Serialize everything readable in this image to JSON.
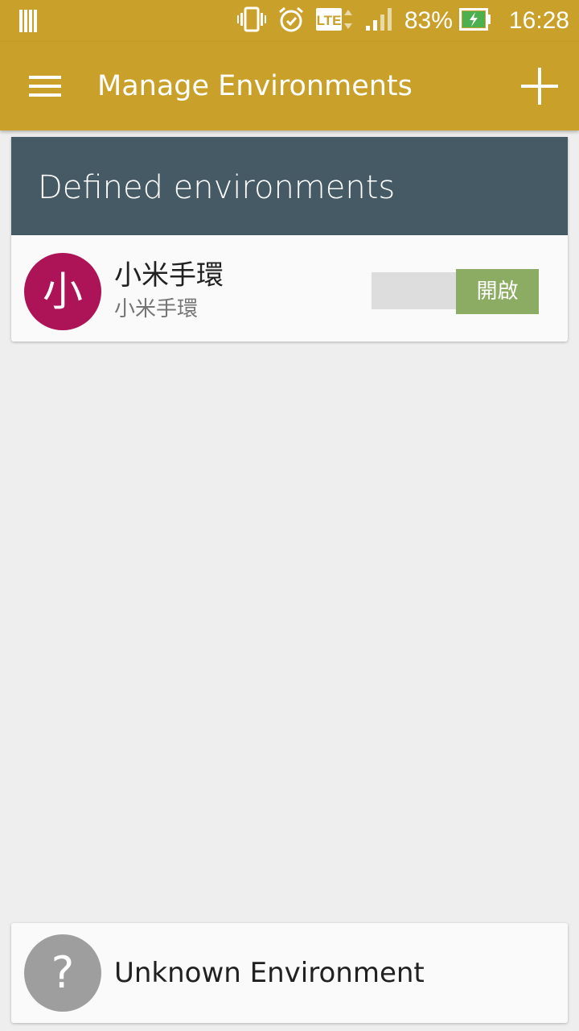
{
  "status_bar": {
    "battery_percent": "83%",
    "time": "16:28",
    "network": "LTE",
    "icons": [
      "notification-bars-icon",
      "vibrate-icon",
      "alarm-icon",
      "lte-icon",
      "signal-icon",
      "battery-charging-icon"
    ]
  },
  "app_bar": {
    "title": "Manage Environments",
    "menu_icon": "hamburger-menu-icon",
    "add_icon": "plus-icon",
    "color": "#c9a029"
  },
  "defined_section": {
    "title": "Defined environments",
    "color": "#455a64"
  },
  "environments": [
    {
      "avatar_letter": "小",
      "avatar_color": "#ad1457",
      "name": "小米手環",
      "subtitle": "小米手環",
      "toggle_label": "開啟",
      "toggle_on": true,
      "toggle_color": "#8bac62"
    }
  ],
  "unknown": {
    "avatar_symbol": "?",
    "avatar_color": "#9e9e9e",
    "label": "Unknown Environment"
  }
}
